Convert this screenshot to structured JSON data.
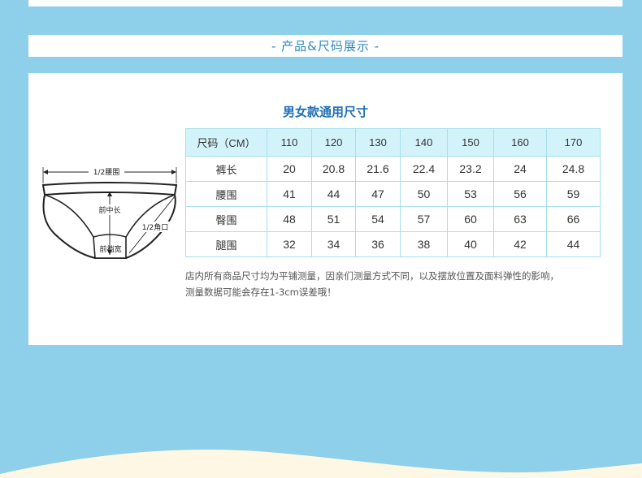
{
  "banner": {
    "title": "- 产品&尺码展示 -"
  },
  "panel": {
    "title": "男女款通用尺寸",
    "diagram": {
      "labels": {
        "waist": "1/2腰围",
        "front_rise": "前中长",
        "leg_opening": "1/2角口",
        "crotch_width": "前裆宽"
      }
    },
    "table": {
      "header": [
        "尺码（CM）",
        "110",
        "120",
        "130",
        "140",
        "150",
        "160",
        "170"
      ],
      "rows": [
        {
          "label": "裤长",
          "values": [
            "20",
            "20.8",
            "21.6",
            "22.4",
            "23.2",
            "24",
            "24.8"
          ]
        },
        {
          "label": "腰围",
          "values": [
            "41",
            "44",
            "47",
            "50",
            "53",
            "56",
            "59"
          ]
        },
        {
          "label": "臀围",
          "values": [
            "48",
            "51",
            "54",
            "57",
            "60",
            "63",
            "66"
          ]
        },
        {
          "label": "腿围",
          "values": [
            "32",
            "34",
            "36",
            "38",
            "40",
            "42",
            "44"
          ]
        }
      ]
    },
    "note": {
      "line1": "店内所有商品尺寸均为平铺测量，因亲们测量方式不同，以及摆放位置及面料弹性的影响，",
      "line2": "测量数据可能会存在1-3cm误差哦！"
    }
  },
  "colors": {
    "background": "#8ecfea",
    "accent_blue": "#1d6fb5",
    "table_border": "#a7dfec",
    "table_header_bg": "#d3f3fa",
    "wave": "#fdf7e4"
  }
}
